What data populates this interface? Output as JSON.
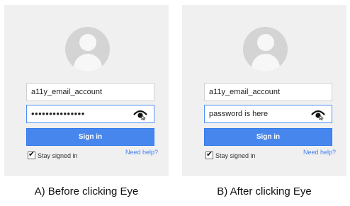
{
  "panels": [
    {
      "email_value": "a11y_email_account",
      "password_display": "•••••••••••••••",
      "signin_label": "Sign in",
      "stay_signed_label": "Stay signed in",
      "stay_signed_checked": true,
      "help_label": "Need help?",
      "caption": "A) Before clicking Eye",
      "eye_icon": "eye-icon"
    },
    {
      "email_value": "a11y_email_account",
      "password_display": "password is here",
      "signin_label": "Sign in",
      "stay_signed_label": "Stay signed in",
      "stay_signed_checked": true,
      "help_label": "Need help?",
      "caption": "B) After clicking Eye",
      "eye_icon": "eye-icon"
    }
  ],
  "colors": {
    "panel_bg": "#f0f0f0",
    "signin_blue": "#4787ed",
    "focus_border": "#4d90fe",
    "link_blue": "#427fed"
  }
}
